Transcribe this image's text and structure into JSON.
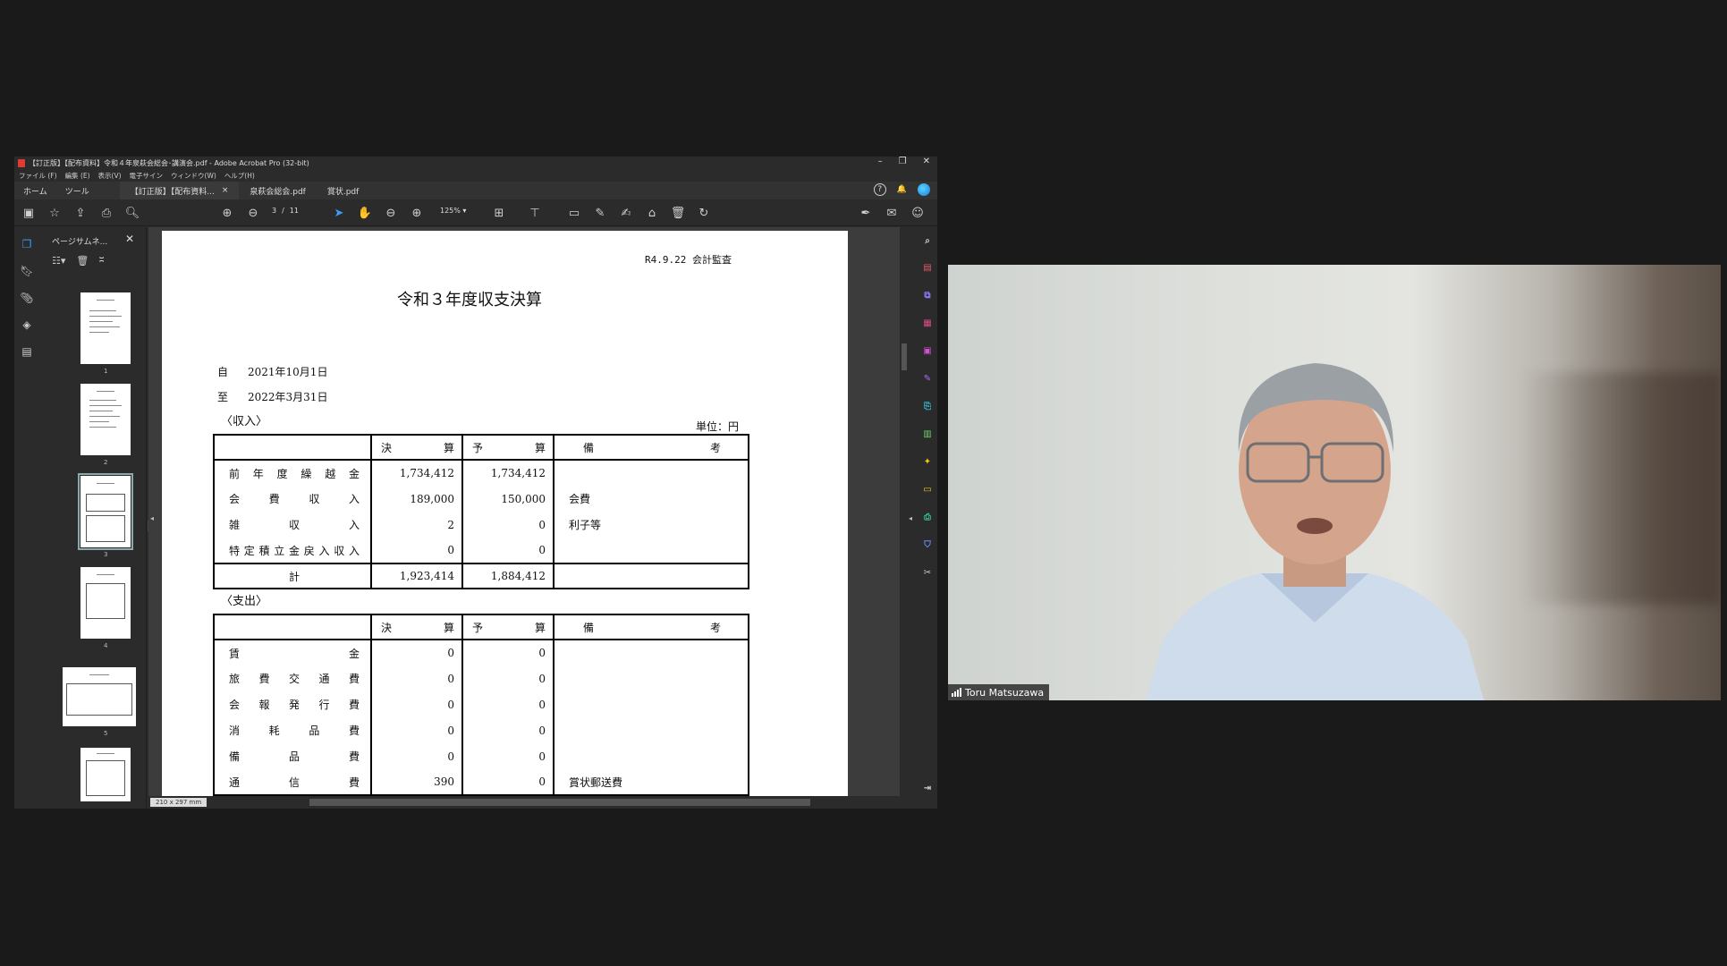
{
  "window": {
    "title": "【訂正版】【配布資料】令和４年泉萩会総会･講演会.pdf - Adobe Acrobat Pro (32-bit)",
    "minimize": "–",
    "restore": "❐",
    "close": "✕"
  },
  "menu": [
    "ファイル (F)",
    "編集 (E)",
    "表示(V)",
    "電子サイン",
    "ウィンドウ(W)",
    "ヘルプ(H)"
  ],
  "tabs": {
    "home": "ホーム",
    "tools": "ツール",
    "docs": [
      {
        "label": "【訂正版】【配布資料...",
        "close": "×"
      },
      {
        "label": "泉萩会総会.pdf",
        "close": ""
      },
      {
        "label": "賞状.pdf",
        "close": ""
      }
    ],
    "help": "?"
  },
  "toolbar": {
    "page_current": "3",
    "page_sep": "/",
    "page_total": "11",
    "zoom": "125%",
    "zoom_arrow": "▾"
  },
  "thumb_panel": {
    "title": "ページサムネ...",
    "close": "✕",
    "pages": [
      "1",
      "2",
      "3",
      "4",
      "5"
    ]
  },
  "document": {
    "tag": "R4.9.22 会計監査",
    "title": "令和３年度収支決算",
    "from_label": "自",
    "from_date": "2021年10月1日",
    "to_label": "至",
    "to_date": "2022年3月31日",
    "income_heading": "〈収入〉",
    "expense_heading": "〈支出〉",
    "unit": "単位：円",
    "headers": [
      "",
      "決　算",
      "予　算",
      "備　考"
    ],
    "income_rows": [
      [
        "前年度繰越金",
        "1,734,412",
        "1,734,412",
        ""
      ],
      [
        "会費収入",
        "189,000",
        "150,000",
        "会費"
      ],
      [
        "雑収入",
        "2",
        "0",
        "利子等"
      ],
      [
        "特定積立金戻入収入",
        "0",
        "0",
        ""
      ]
    ],
    "income_total": [
      "計",
      "1,923,414",
      "1,884,412",
      ""
    ],
    "expense_rows": [
      [
        "賃金",
        "0",
        "0",
        ""
      ],
      [
        "旅費交通費",
        "0",
        "0",
        ""
      ],
      [
        "会報発行費",
        "0",
        "0",
        ""
      ],
      [
        "消耗品費",
        "0",
        "0",
        ""
      ],
      [
        "備品費",
        "0",
        "0",
        ""
      ],
      [
        "通信費",
        "390",
        "0",
        "賞状郵送費"
      ]
    ]
  },
  "statusbar": {
    "page_size": "210 x 297 mm"
  },
  "video": {
    "participant_name": "Toru Matsuzawa"
  },
  "colors": {
    "accent": "#3d9bff",
    "pdf_red": "#e03c31"
  }
}
